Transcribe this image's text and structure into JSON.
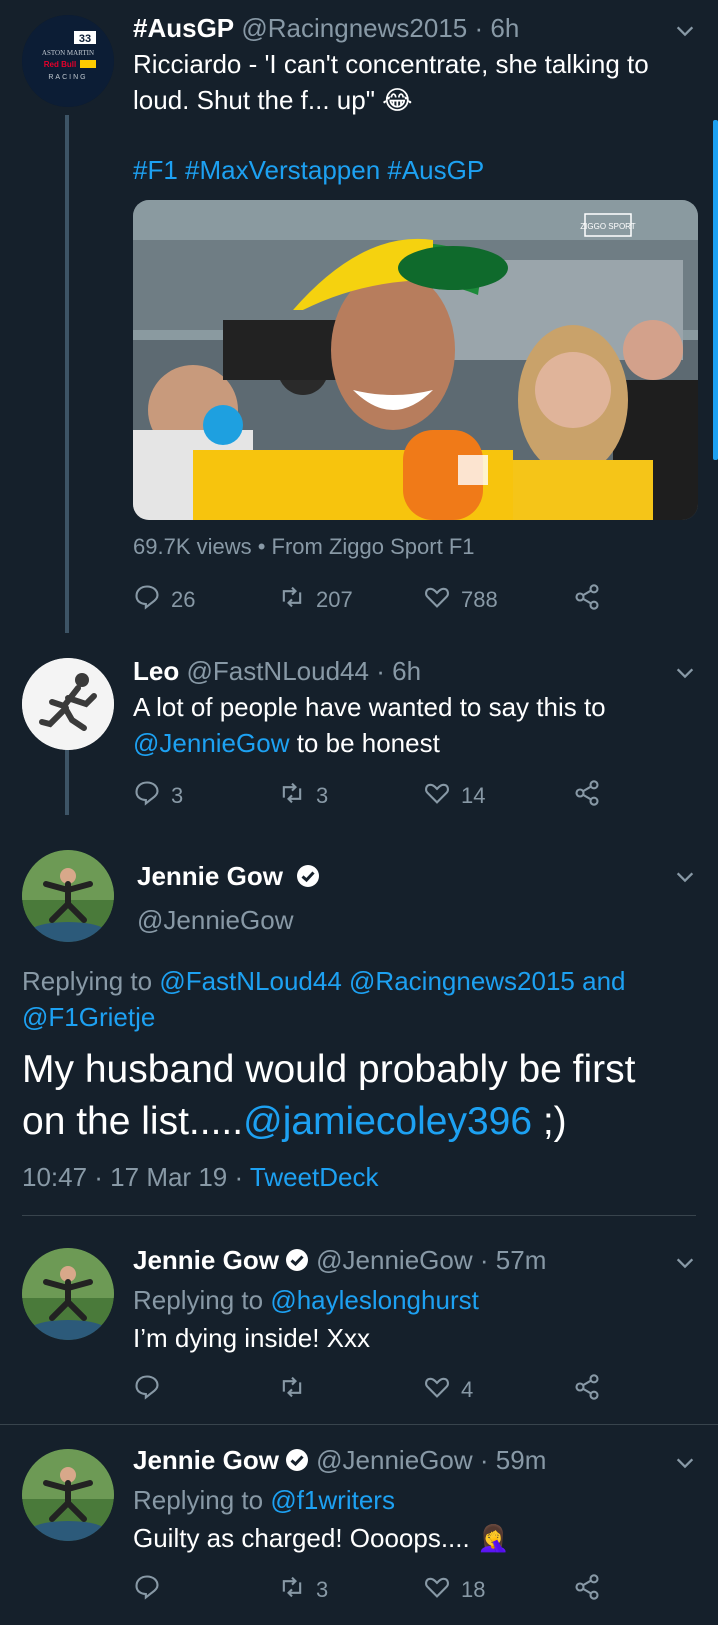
{
  "tweet1": {
    "name": "#AusGP",
    "handle": "@Racingnews2015",
    "time": "6h",
    "text": "Ricciardo - 'I can't concentrate, she talking to loud. Shut the f... up\" 😂",
    "hashtags": "#F1 #MaxVerstappen #AusGP",
    "video_meta": "69.7K views • From Ziggo Sport F1",
    "video_logo": "ZIGGO SPORT",
    "avatar_text_1": "33",
    "avatar_text_2": "ASTON MARTIN",
    "avatar_text_3": "Red Bull",
    "avatar_text_4": "RACING",
    "reply_count": "26",
    "retweet_count": "207",
    "like_count": "788"
  },
  "tweet2": {
    "name": "Leo",
    "handle": "@FastNLoud44",
    "time": "6h",
    "text_before": "A lot of people have wanted to say this to",
    "mention": "@JennieGow",
    "text_after": " to be honest",
    "reply_count": "3",
    "retweet_count": "3",
    "like_count": "14"
  },
  "main": {
    "name": "Jennie Gow",
    "handle": "@JennieGow",
    "replying_label": "Replying to",
    "replying_to": "@FastNLoud44 @Racingnews2015 and @F1Grietje",
    "text_before": "My husband would probably be first on the list.....",
    "mention": "@jamiecoley396",
    "text_after": " ;)",
    "timestamp": "10:47 · 17 Mar 19 · ",
    "source": "TweetDeck"
  },
  "reply1": {
    "name": "Jennie Gow",
    "handle": "@JennieGow",
    "time": "57m",
    "replying_label": "Replying to",
    "replying_to": "@hayleslonghurst",
    "text": "I’m dying inside! Xxx",
    "like_count": "4"
  },
  "reply2": {
    "name": "Jennie Gow",
    "handle": "@JennieGow",
    "time": "59m",
    "replying_label": "Replying to",
    "replying_to": "@f1writers",
    "text": "Guilty as charged! Oooops.... 🤦‍♀️",
    "retweet_count": "3",
    "like_count": "18"
  },
  "colors": {
    "background": "#15202b",
    "link": "#1da1f2",
    "muted": "#8899a6",
    "thread_line": "#3d5466"
  }
}
